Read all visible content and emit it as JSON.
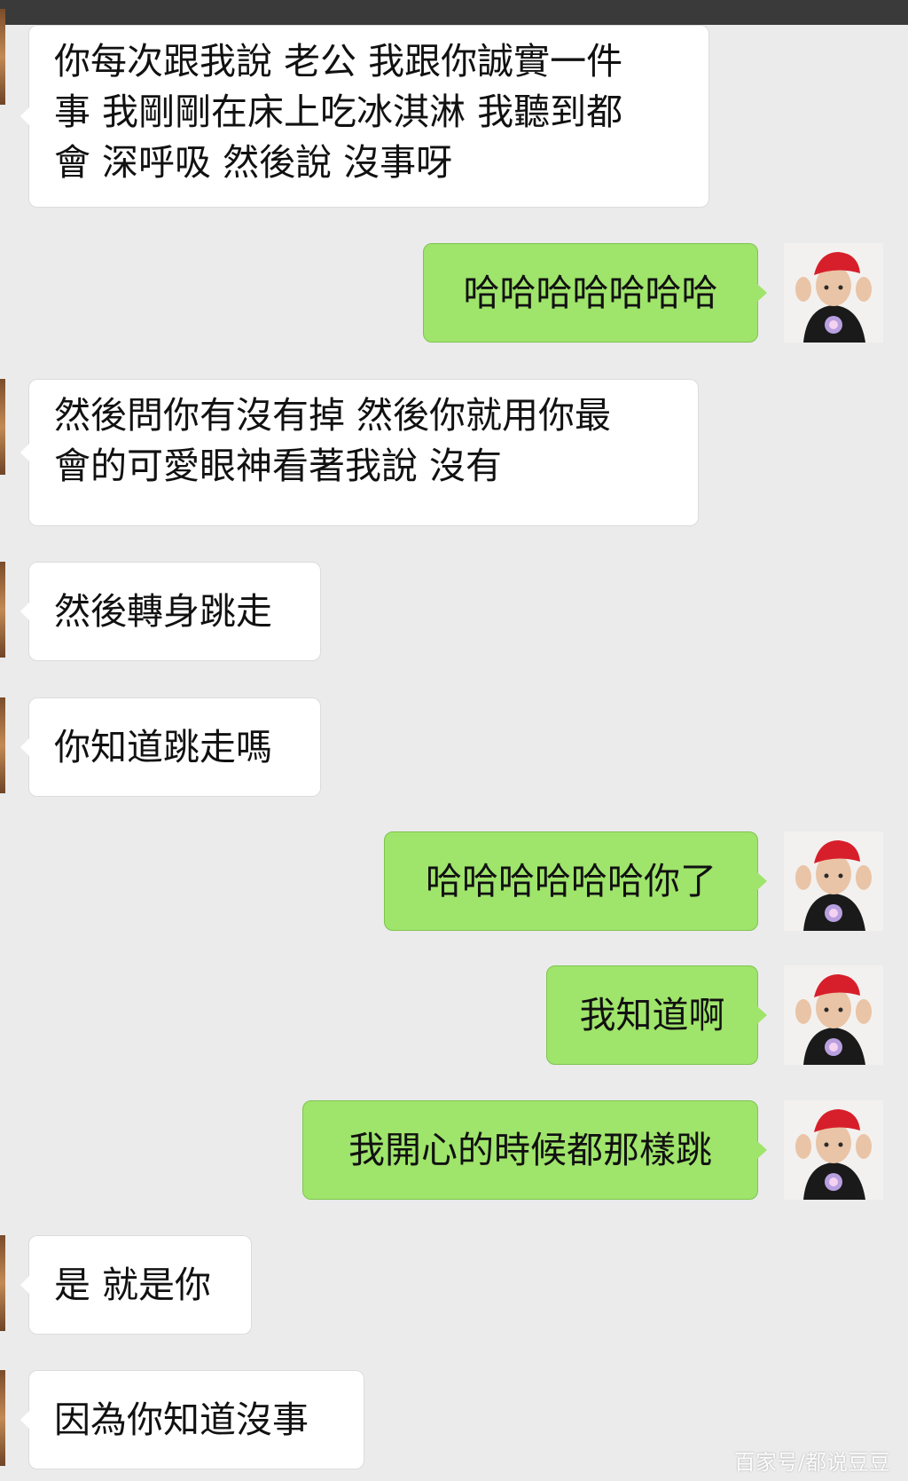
{
  "messages": [
    {
      "side": "in",
      "text": "你每次跟我說 老公 我跟你誠實一件\n事 我剛剛在床上吃冰淇淋 我聽到都\n會 深呼吸 然後說 沒事呀"
    },
    {
      "side": "out",
      "text": "哈哈哈哈哈哈哈"
    },
    {
      "side": "in",
      "text": "然後問你有沒有掉 然後你就用你最\n會的可愛眼神看著我說 沒有"
    },
    {
      "side": "in",
      "text": "然後轉身跳走"
    },
    {
      "side": "in",
      "text": "你知道跳走嗎"
    },
    {
      "side": "out",
      "text": "哈哈哈哈哈哈你了"
    },
    {
      "side": "out",
      "text": "我知道啊"
    },
    {
      "side": "out",
      "text": "我開心的時候都那樣跳"
    },
    {
      "side": "in",
      "text": "是 就是你"
    },
    {
      "side": "in",
      "text": "因為你知道沒事"
    }
  ],
  "watermark": "百家号/都说豆豆",
  "colors": {
    "background": "#ebebeb",
    "incoming_bubble": "#ffffff",
    "outgoing_bubble": "#9fe46b",
    "top_bar": "#3a3a3a"
  },
  "icons": {
    "self_avatar": "child-red-cap-avatar-icon"
  }
}
